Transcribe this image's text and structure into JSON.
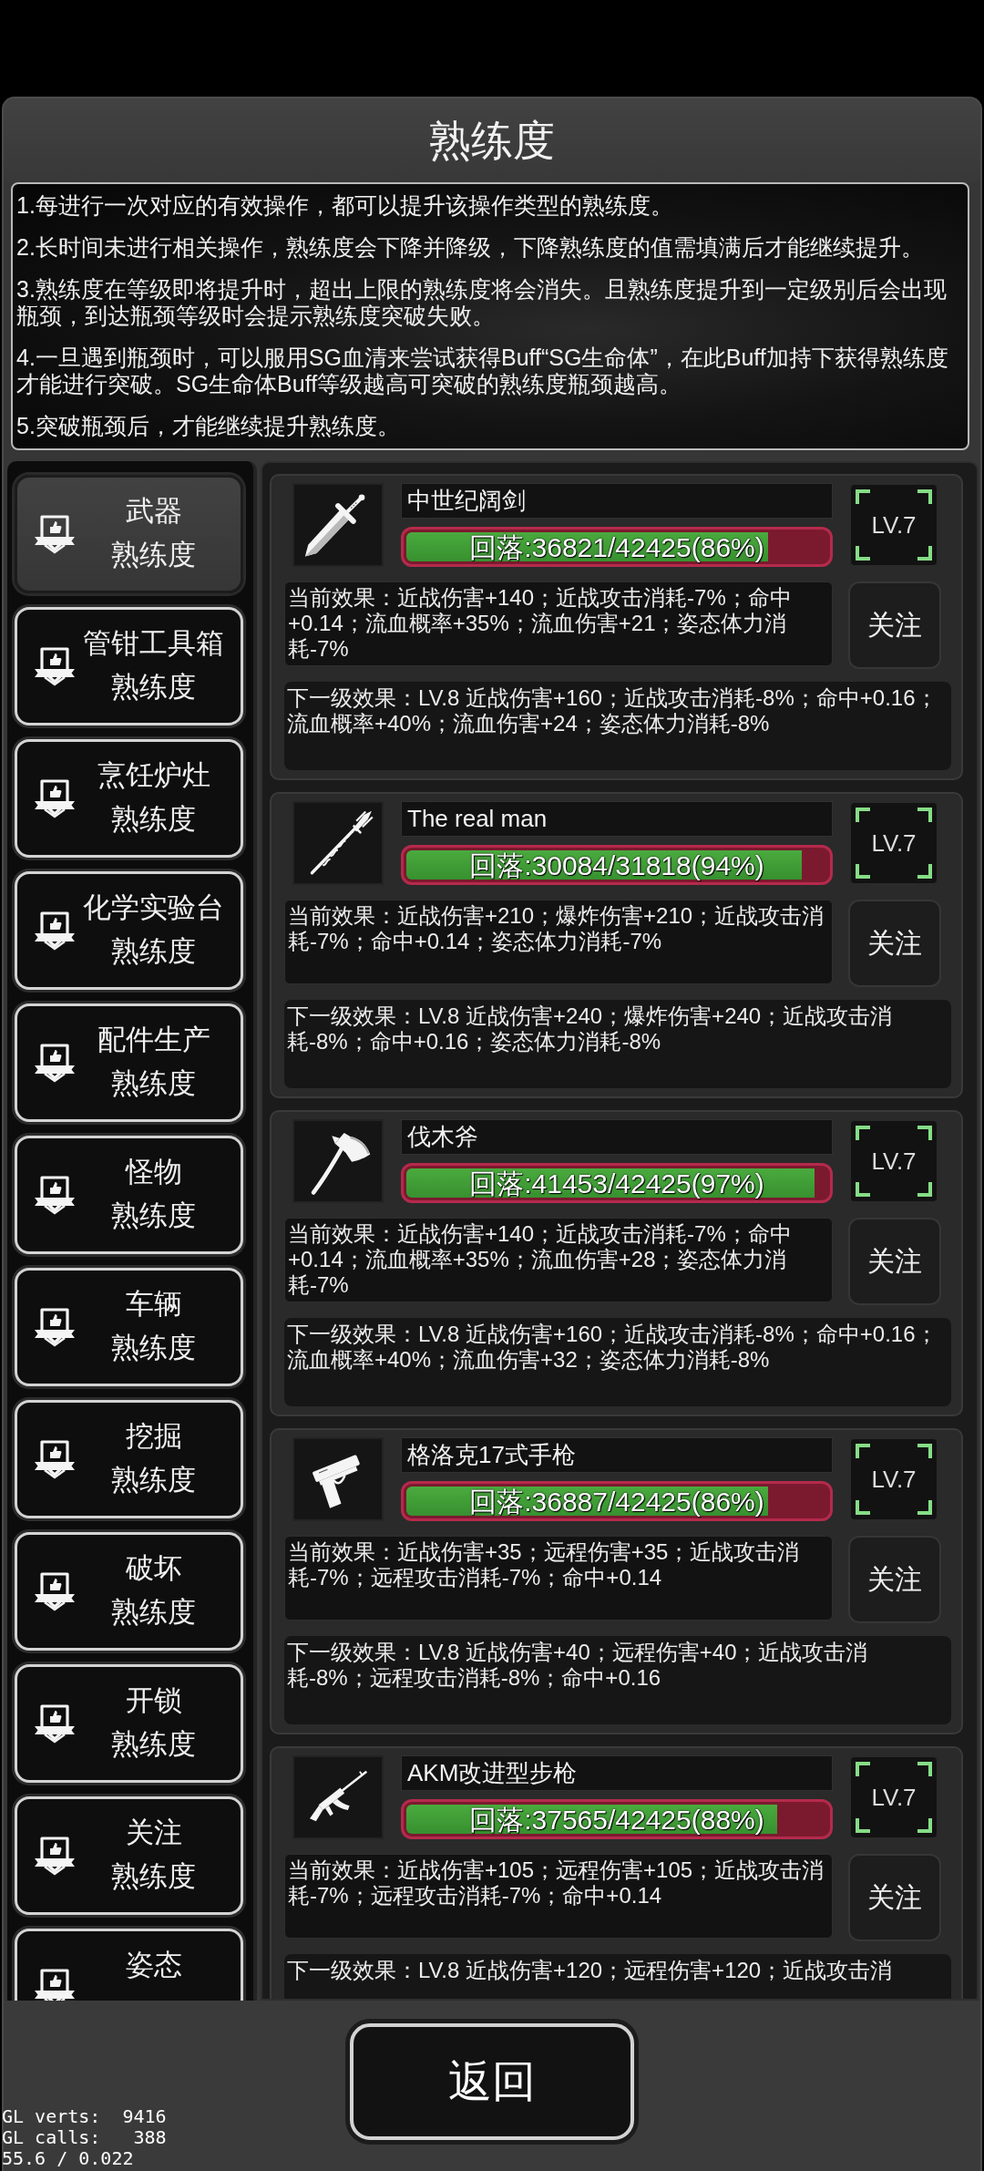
{
  "title": "熟练度",
  "rules": [
    "1.每进行一次对应的有效操作，都可以提升该操作类型的熟练度。",
    "2.长时间未进行相关操作，熟练度会下降并降级，下降熟练度的值需填满后才能继续提升。",
    "3.熟练度在等级即将提升时，超出上限的熟练度将会消失。且熟练度提升到一定级别后会出现瓶颈，到达瓶颈等级时会提示熟练度突破失败。",
    "4.一旦遇到瓶颈时，可以服用SG血清来尝试获得Buff“SG生命体”，在此Buff加持下获得熟练度才能进行突破。SG生命体Buff等级越高可突破的熟练度瓶颈越高。",
    "5.突破瓶颈后，才能继续提升熟练度。"
  ],
  "categories": [
    {
      "name": "武器",
      "suffix": "熟练度",
      "selected": true
    },
    {
      "name": "管钳工具箱",
      "suffix": "熟练度",
      "selected": false
    },
    {
      "name": "烹饪炉灶",
      "suffix": "熟练度",
      "selected": false
    },
    {
      "name": "化学实验台",
      "suffix": "熟练度",
      "selected": false
    },
    {
      "name": "配件生产",
      "suffix": "熟练度",
      "selected": false
    },
    {
      "name": "怪物",
      "suffix": "熟练度",
      "selected": false
    },
    {
      "name": "车辆",
      "suffix": "熟练度",
      "selected": false
    },
    {
      "name": "挖掘",
      "suffix": "熟练度",
      "selected": false
    },
    {
      "name": "破坏",
      "suffix": "熟练度",
      "selected": false
    },
    {
      "name": "开锁",
      "suffix": "熟练度",
      "selected": false
    },
    {
      "name": "关注",
      "suffix": "熟练度",
      "selected": false
    },
    {
      "name": "姿态",
      "selected": false
    }
  ],
  "items": [
    {
      "kind": "sword",
      "name": "中世纪阔剑",
      "progress_text": "回落:36821/42425(86%)",
      "level": 0.86,
      "rank": "LV.7",
      "current_effect": "当前效果：近战伤害+140；近战攻击消耗-7%；命中+0.14；流血概率+35%；流血伤害+21；姿态体力消耗-7%",
      "follow_button": "关注",
      "next_effect": "下一级效果：LV.8 近战伤害+160；近战攻击消耗-8%；命中+0.16；流血概率+40%；流血伤害+24；姿态体力消耗-8%"
    },
    {
      "kind": "spear",
      "name": "The real man",
      "progress_text": "回落:30084/31818(94%)",
      "level": 0.94,
      "rank": "LV.7",
      "current_effect": "当前效果：近战伤害+210；爆炸伤害+210；近战攻击消耗-7%；命中+0.14；姿态体力消耗-7%",
      "follow_button": "关注",
      "next_effect": "下一级效果：LV.8 近战伤害+240；爆炸伤害+240；近战攻击消耗-8%；命中+0.16；姿态体力消耗-8%"
    },
    {
      "kind": "axe",
      "name": "伐木斧",
      "progress_text": "回落:41453/42425(97%)",
      "level": 0.97,
      "rank": "LV.7",
      "current_effect": "当前效果：近战伤害+140；近战攻击消耗-7%；命中+0.14；流血概率+35%；流血伤害+28；姿态体力消耗-7%",
      "follow_button": "关注",
      "next_effect": "下一级效果：LV.8 近战伤害+160；近战攻击消耗-8%；命中+0.16；流血概率+40%；流血伤害+32；姿态体力消耗-8%"
    },
    {
      "kind": "pistol",
      "name": "格洛克17式手枪",
      "progress_text": "回落:36887/42425(86%)",
      "level": 0.86,
      "rank": "LV.7",
      "current_effect": "当前效果：近战伤害+35；远程伤害+35；近战攻击消耗-7%；远程攻击消耗-7%；命中+0.14",
      "follow_button": "关注",
      "next_effect": "下一级效果：LV.8 近战伤害+40；远程伤害+40；近战攻击消耗-8%；远程攻击消耗-8%；命中+0.16"
    },
    {
      "kind": "rifle",
      "name": "AKM改进型步枪",
      "progress_text": "回落:37565/42425(88%)",
      "level": 0.88,
      "rank": "LV.7",
      "current_effect": "当前效果：近战伤害+105；远程伤害+105；近战攻击消耗-7%；远程攻击消耗-7%；命中+0.14",
      "follow_button": "关注",
      "next_effect": "下一级效果：LV.8 近战伤害+120；远程伤害+120；近战攻击消"
    }
  ],
  "back_button": "返回",
  "debug_overlay": [
    "GL verts:  9416",
    "GL calls:   388",
    "55.6 / 0.022"
  ]
}
